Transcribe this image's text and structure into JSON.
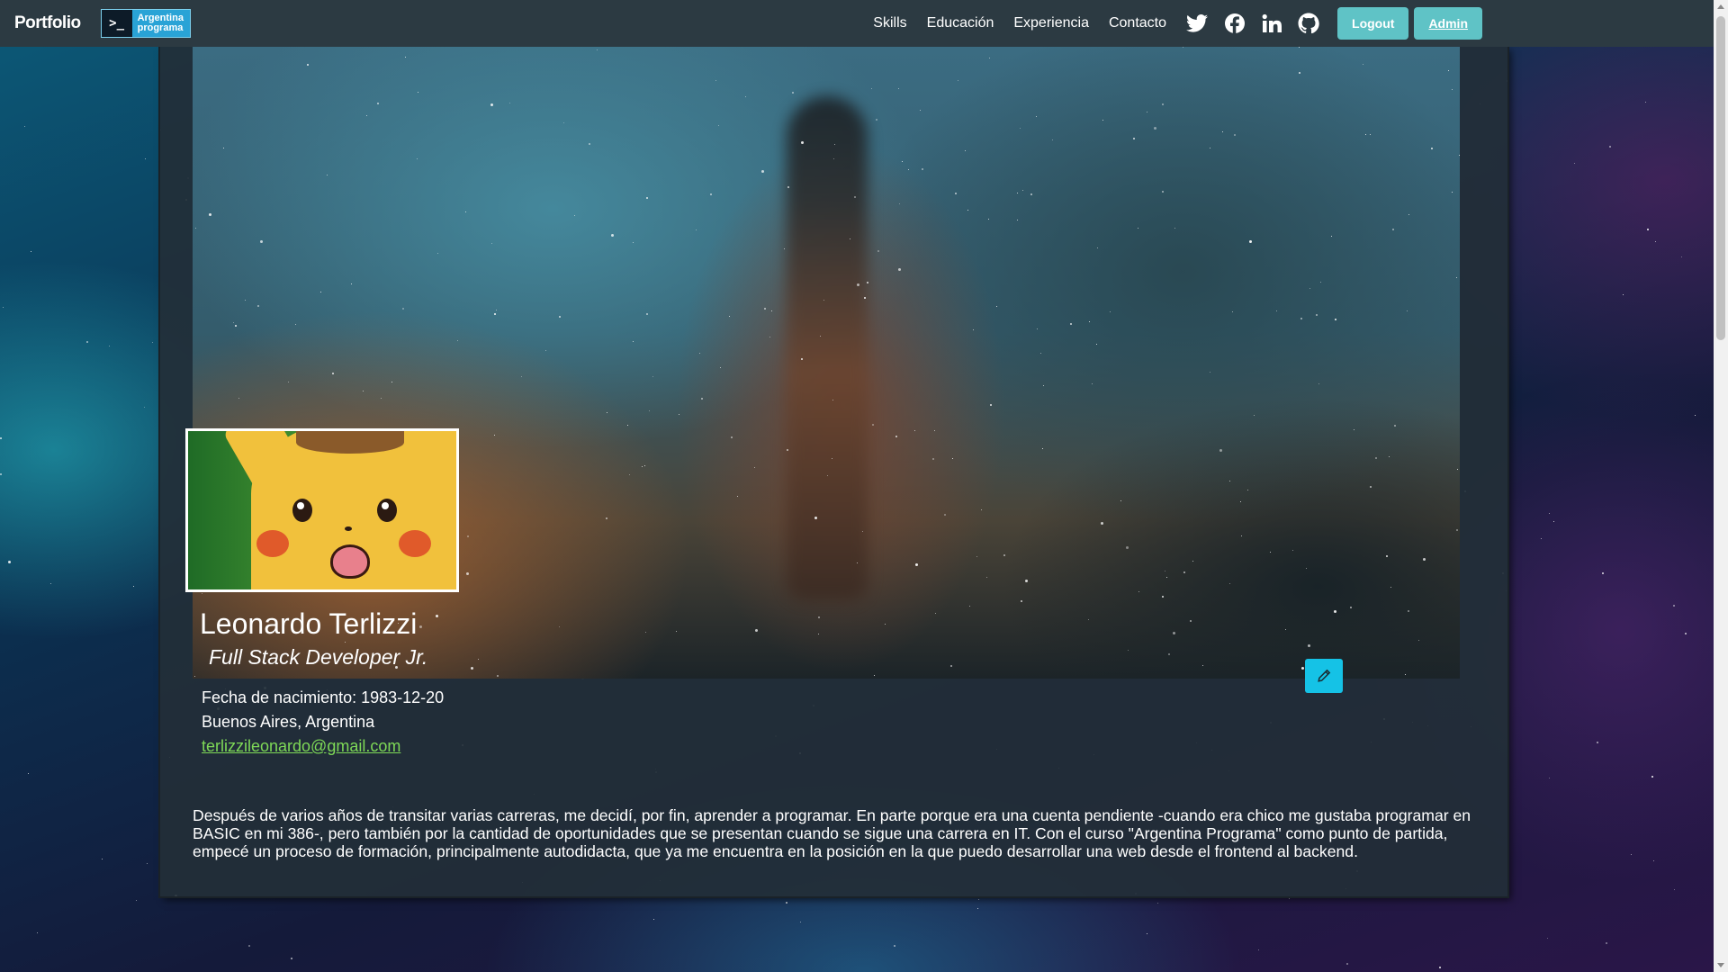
{
  "navbar": {
    "brand": "Portfolio",
    "logo": {
      "term": ">_",
      "line1": "Argentina",
      "line2": "programa"
    },
    "links": [
      "Skills",
      "Educación",
      "Experiencia",
      "Contacto"
    ],
    "social_icons": [
      "twitter-icon",
      "facebook-icon",
      "linkedin-icon",
      "github-icon"
    ],
    "logout_label": "Logout",
    "admin_label": "Admin"
  },
  "profile": {
    "name": "Leonardo Terlizzi",
    "role": "Full Stack Developer Jr.",
    "birth": "Fecha de nacimiento: 1983-12-20",
    "location": "Buenos Aires, Argentina",
    "email": "terlizzileonardo@gmail.com",
    "about": "Después de varios años de transitar varias carreras, me decidí, por fin, aprender a programar. En parte porque era una cuenta pendiente -cuando era chico me gustaba programar en BASIC en mi 386-, pero también por la cantidad de oportunidades que se presentan cuando se sigue una carrera en IT. Con el curso \"Argentina Programa\" como punto de partida, empecé un proceso de formación, principalmente autodidacta, que ya me encuentra en la posición en la que puedo desarrollar una web desde el frontend al backend."
  },
  "colors": {
    "navbar_bg": "#2c3a42",
    "button_accent": "#5fc3c6",
    "edit_button": "#15c2e6",
    "email_link": "#7ed957"
  },
  "icons": {
    "edit": "pencil-icon"
  }
}
